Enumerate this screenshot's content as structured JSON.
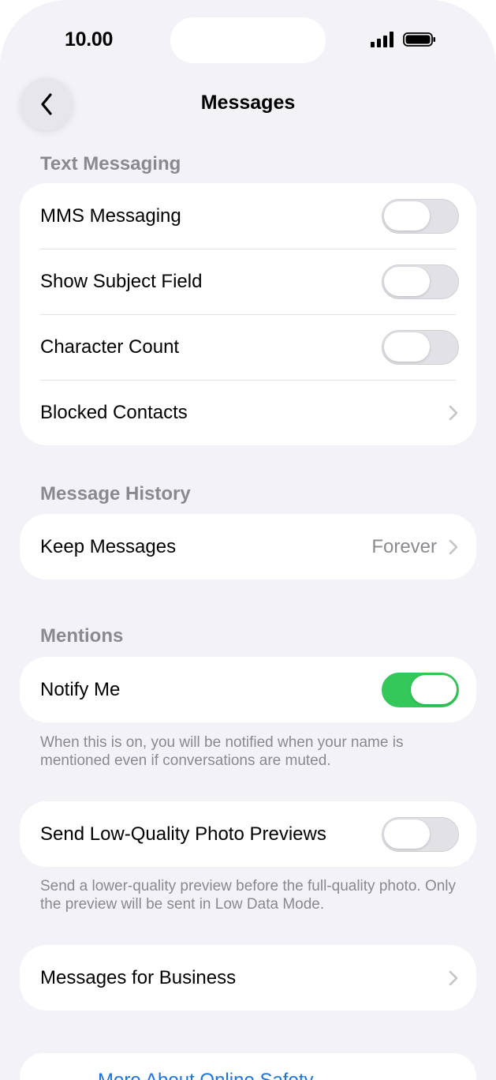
{
  "status_bar": {
    "time": "10.00"
  },
  "nav": {
    "title": "Messages"
  },
  "text_messaging": {
    "header": "Text Messaging",
    "rows": [
      {
        "label": "MMS Messaging",
        "toggle_on": false
      },
      {
        "label": "Show Subject Field",
        "toggle_on": false
      },
      {
        "label": "Character Count",
        "toggle_on": false
      },
      {
        "label": "Blocked Contacts"
      }
    ]
  },
  "message_history": {
    "header": "Message History",
    "keep_messages": {
      "label": "Keep Messages",
      "value": "Forever"
    }
  },
  "mentions": {
    "header": "Mentions",
    "notify_me": {
      "label": "Notify Me",
      "toggle_on": true
    },
    "footer": "When this is on, you will be notified when your name is mentioned even if conversations are muted."
  },
  "low_quality": {
    "label": "Send Low-Quality Photo Previews",
    "toggle_on": false,
    "footer": "Send a lower-quality preview before the full-quality photo. Only the preview will be sent in Low Data Mode."
  },
  "business": {
    "label": "Messages for Business"
  },
  "bottom_link": {
    "label": "More About Online Safety"
  },
  "colors": {
    "accent_green": "#34c759",
    "link_blue": "#1e74d9",
    "secondary_text": "#8a8a8e",
    "background": "#f2f2f7"
  },
  "icons": {
    "back": "chevron-left-icon",
    "disclosure": "chevron-right-icon",
    "signal": "cellular-signal-icon",
    "battery": "battery-icon"
  }
}
